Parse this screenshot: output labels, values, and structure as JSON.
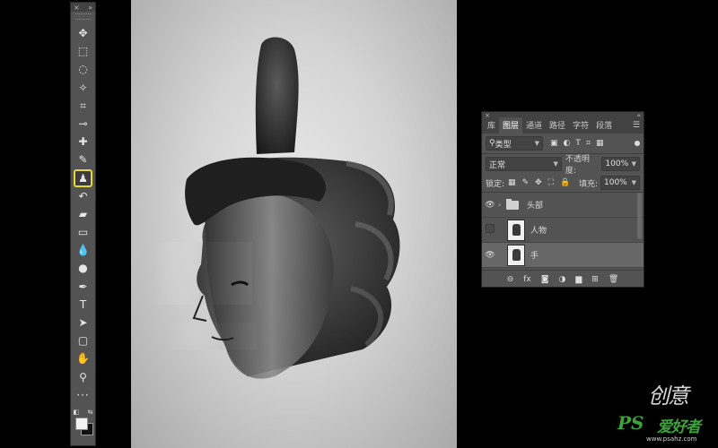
{
  "toolbar": {
    "close": "×",
    "collapse": "»",
    "tools": [
      {
        "name": "move-tool",
        "glyph": "✥"
      },
      {
        "name": "marquee-tool",
        "glyph": "⬚"
      },
      {
        "name": "lasso-tool",
        "glyph": "◌"
      },
      {
        "name": "magic-wand-tool",
        "glyph": "✧"
      },
      {
        "name": "crop-tool",
        "glyph": "⌗"
      },
      {
        "name": "eyedropper-tool",
        "glyph": "⊸"
      },
      {
        "name": "healing-brush-tool",
        "glyph": "✚"
      },
      {
        "name": "brush-tool",
        "glyph": "✎"
      },
      {
        "name": "clone-stamp-tool",
        "glyph": "♟"
      },
      {
        "name": "history-brush-tool",
        "glyph": "↶"
      },
      {
        "name": "eraser-tool",
        "glyph": "▰"
      },
      {
        "name": "gradient-tool",
        "glyph": "▭"
      },
      {
        "name": "blur-tool",
        "glyph": "💧"
      },
      {
        "name": "dodge-tool",
        "glyph": "●"
      },
      {
        "name": "pen-tool",
        "glyph": "✒"
      },
      {
        "name": "type-tool",
        "glyph": "T"
      },
      {
        "name": "path-selection-tool",
        "glyph": "➤"
      },
      {
        "name": "rectangle-tool",
        "glyph": "▢"
      },
      {
        "name": "hand-tool",
        "glyph": "✋"
      },
      {
        "name": "zoom-tool",
        "glyph": "⚲"
      }
    ],
    "active_tool": "clone-stamp-tool",
    "more": "···",
    "default_colors": "◧",
    "swap_colors": "⇆",
    "foreground_color": "#f2f2f2",
    "background_color": "#111111"
  },
  "layers_panel": {
    "close": "×",
    "collapse": "«",
    "tabs": [
      "库",
      "图层",
      "通道",
      "路径",
      "字符",
      "段落"
    ],
    "active_tab": "图层",
    "menu": "☰",
    "filter": {
      "label": "类型",
      "icon": "⚲"
    },
    "filter_icons": [
      "▣",
      "◐",
      "T",
      "⌗",
      "▦"
    ],
    "blend_mode": "正常",
    "opacity_label": "不透明度:",
    "opacity_value": "100%",
    "lock_label": "锁定:",
    "lock_icons": [
      "▦",
      "✎",
      "✥",
      "⛶",
      "🔒"
    ],
    "fill_label": "填充:",
    "fill_value": "100%",
    "layers": [
      {
        "name": "头部",
        "type": "group",
        "visible": true,
        "selected": false
      },
      {
        "name": "人物",
        "type": "pixel",
        "visible": false,
        "selected": false
      },
      {
        "name": "手",
        "type": "pixel",
        "visible": true,
        "selected": true
      }
    ],
    "bottom_icons": [
      "⊖",
      "fx",
      "◙",
      "◑",
      "▆",
      "⊞",
      "🗑"
    ]
  },
  "watermark": {
    "brand_text": "创意",
    "ps_text": "PS",
    "site_text": "爱好者",
    "url": "www.psahz.com"
  }
}
